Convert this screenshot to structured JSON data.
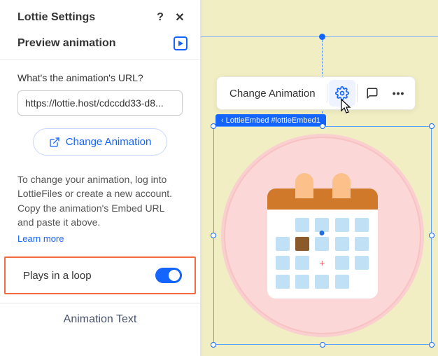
{
  "panel": {
    "title": "Lottie Settings",
    "preview_label": "Preview animation",
    "url_label": "What's the animation's URL?",
    "url_value": "https://lottie.host/cdccdd33-d8...",
    "change_button": "Change Animation",
    "help_text": "To change your animation, log into LottieFiles or create a new account. Copy the animation's Embed URL and paste it above.",
    "learn_more": "Learn more",
    "loop_label": "Plays in a loop",
    "loop_on": true,
    "footer": "Animation Text"
  },
  "toolbar": {
    "change_label": "Change Animation"
  },
  "element_tag": "LottieEmbed #lottieEmbed1",
  "icons": {
    "help": "?",
    "close": "✕",
    "more": "•••"
  }
}
